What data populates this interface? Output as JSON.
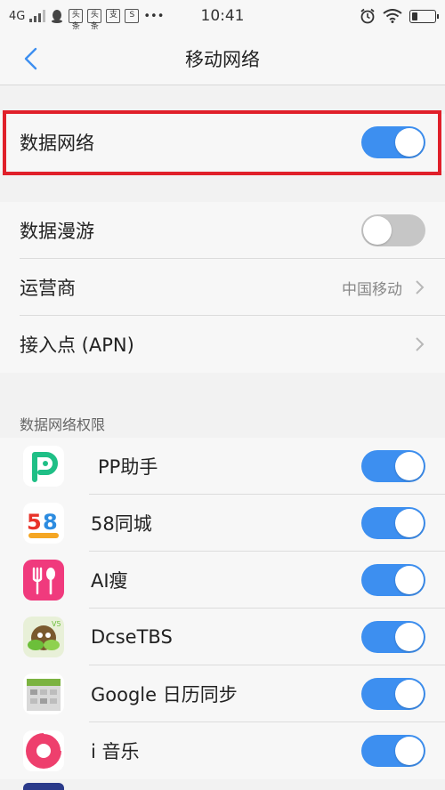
{
  "status_bar": {
    "network": "4G",
    "time": "10:41",
    "notif_icons": [
      "qq-icon",
      "toutiao-icon",
      "toutiao-icon",
      "alipay-icon",
      "s-icon"
    ],
    "notif_labels": [
      "头条",
      "头条",
      "支",
      "S"
    ],
    "more": "•••"
  },
  "nav": {
    "title": "移动网络"
  },
  "rows": {
    "data_network": {
      "label": "数据网络",
      "on": true
    },
    "data_roaming": {
      "label": "数据漫游",
      "on": false
    },
    "carrier": {
      "label": "运营商",
      "value": "中国移动"
    },
    "apn": {
      "label": "接入点 (APN)"
    }
  },
  "permissions": {
    "header": "数据网络权限",
    "apps": [
      {
        "name": "PP助手",
        "icon": "pp-assistant-icon",
        "on": true
      },
      {
        "name": "58同城",
        "icon": "58-tongcheng-icon",
        "on": true
      },
      {
        "name": "AI瘦",
        "icon": "ai-shou-icon",
        "on": true
      },
      {
        "name": "DcseTBS",
        "icon": "dcsetbs-icon",
        "on": true
      },
      {
        "name": "Google 日历同步",
        "icon": "google-calendar-sync-icon",
        "on": true
      },
      {
        "name": "i 音乐",
        "icon": "i-music-icon",
        "on": true
      }
    ]
  },
  "colors": {
    "accent": "#3d8ff0",
    "highlight": "#e0202a",
    "toggle_off": "#c6c6c6"
  }
}
